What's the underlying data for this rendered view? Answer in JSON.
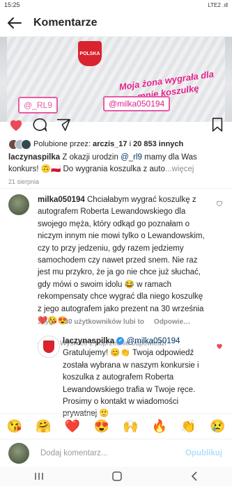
{
  "status": {
    "time": "15:25",
    "right": "LTE2 .ıll"
  },
  "header": {
    "title": "Komentarze"
  },
  "post_image": {
    "tag_rl9": "@_RL9",
    "caption": "Moja żona wygrała dla mnie koszulkę",
    "tag_milka": "@milka050194",
    "crest": "POLSKA"
  },
  "likes": {
    "prefix": "Polubione przez: ",
    "user": "arczis_17",
    "middle": " i ",
    "count": "20 853 innych"
  },
  "caption": {
    "user": "laczynaspilka",
    "text1": " Z okazji urodzin ",
    "mention": "@_rl9",
    "text2": " mamy dla Was konkurs! 🙃🇵🇱 Do wygrania koszulka z auto",
    "more": "...więcej"
  },
  "date": "21 sierpnia",
  "comment": {
    "user": "milka050194",
    "text": " Chciałabym wygrać koszulkę z autografem Roberta Lewandowskiego dla swojego męża, który odkąd go poznałam o niczym innym nie mowi tylko o Lewandowskim, czy to przy jedzeniu, gdy razem jedziemy samochodem czy nawet przed snem. Nie raz jest mu przykro, że ja go nie chce już słuchać, gdy mówi o swoim idolu 😂 w ramach rekompensaty chce wygrać dla niego koszulkę z jego autografem jako prezent na 30 września ❤️😘😍",
    "time": "2 tyg.",
    "likes": "30 użytkowników lubi to",
    "reply": "Odpowie…"
  },
  "view_replies": "Wyświetl 2 poprzednie odpowiedzi",
  "reply": {
    "user": "laczynaspilka",
    "verified": "✔",
    "mention": "@milka050194",
    "text": " Gratulujemy! 😊👏 Twoja odpowiedź została wybrana w naszym konkursie i koszulka z autografem Roberta Lewandowskiego trafia w Twoje ręce. Prosimy o kontakt w wiadomości prywatnej 🙂"
  },
  "emojis": [
    "😘",
    "🤗",
    "❤️",
    "😍",
    "🙌",
    "🔥",
    "👏",
    "😢"
  ],
  "input": {
    "placeholder": "Dodaj komentarz...",
    "post_label": "Opublikuj"
  },
  "colors": {
    "accent": "#ed4956",
    "link": "#003569",
    "tag": "#e0218a",
    "post_disabled": "#b2dffc"
  }
}
